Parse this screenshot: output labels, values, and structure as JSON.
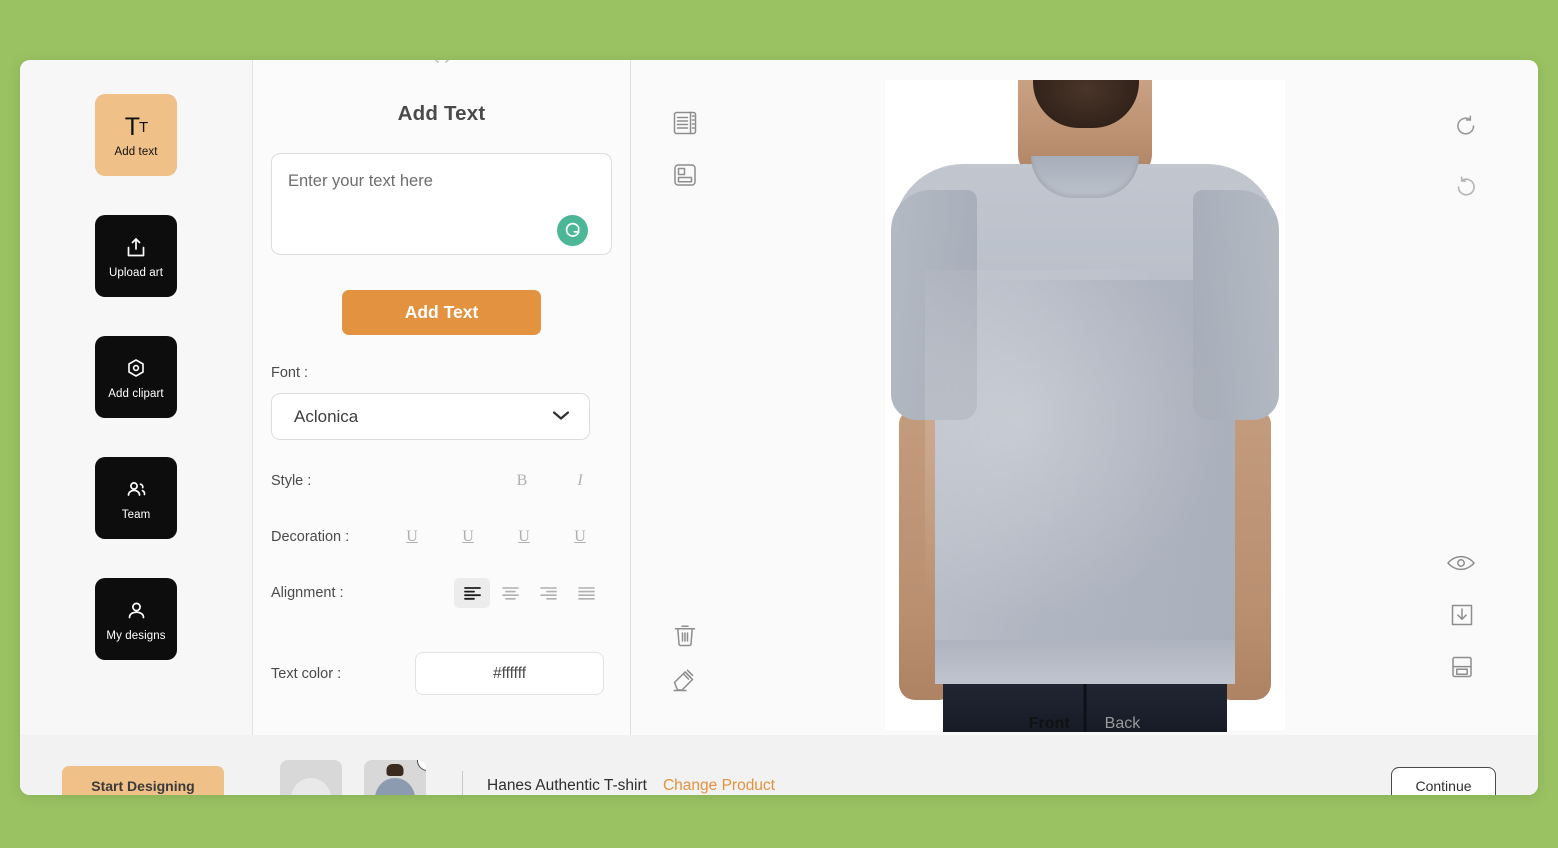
{
  "theme": {
    "page_background": "#9ac262",
    "accent_orange": "#e3923f",
    "accent_peach": "#f0c089",
    "grammar_green": "#4cb796",
    "shirt_color": "#b4bac4"
  },
  "sidebar": {
    "items": [
      {
        "label": "Add text",
        "icon": "text-tool-icon",
        "active": true
      },
      {
        "label": "Upload art",
        "icon": "upload-icon",
        "active": false
      },
      {
        "label": "Add clipart",
        "icon": "clipart-icon",
        "active": false
      },
      {
        "label": "Team",
        "icon": "team-icon",
        "active": false
      },
      {
        "label": "My designs",
        "icon": "my-designs-icon",
        "active": false
      }
    ]
  },
  "panel": {
    "title": "Add Text",
    "textarea_placeholder": "Enter your text here",
    "textarea_value": "",
    "grammar_icon": "grammarly-icon",
    "add_text_button": "Add Text",
    "font_label": "Font :",
    "font_value": "Aclonica",
    "style_label": "Style :",
    "style_options": [
      {
        "name": "bold",
        "glyph": "B",
        "selected": false
      },
      {
        "name": "italic",
        "glyph": "I",
        "selected": false
      }
    ],
    "decoration_label": "Decoration :",
    "decoration_options": [
      {
        "name": "underline",
        "glyph": "U",
        "selected": false
      },
      {
        "name": "double-underline",
        "glyph": "U",
        "selected": false
      },
      {
        "name": "dashed-underline",
        "glyph": "U",
        "selected": false
      },
      {
        "name": "dotted-underline",
        "glyph": "U",
        "selected": false
      }
    ],
    "alignment_label": "Alignment :",
    "alignment_options": [
      {
        "name": "align-left",
        "selected": true
      },
      {
        "name": "align-center",
        "selected": false
      },
      {
        "name": "align-right",
        "selected": false
      },
      {
        "name": "align-justify",
        "selected": false
      }
    ],
    "text_color_label": "Text color :",
    "text_color_value": "#ffffff"
  },
  "canvas": {
    "left_tools": [
      {
        "name": "layers-icon"
      },
      {
        "name": "template-icon"
      },
      {
        "name": "trash-icon"
      },
      {
        "name": "eraser-icon"
      }
    ],
    "right_tools": [
      {
        "name": "undo-icon"
      },
      {
        "name": "redo-icon"
      },
      {
        "name": "preview-eye-icon"
      },
      {
        "name": "download-icon"
      },
      {
        "name": "save-icon"
      }
    ],
    "side_tabs": [
      {
        "label": "Front",
        "active": true
      },
      {
        "label": "Back",
        "active": false
      }
    ]
  },
  "bottom_bar": {
    "cta_label": "Start Designing",
    "product_name": "Hanes Authentic T-shirt",
    "change_product_label": "Change Product",
    "right_button_label": "Continue",
    "thumbnails": [
      {
        "name": "product-thumb-white",
        "has_close": false
      },
      {
        "name": "product-thumb-gray",
        "has_close": true
      }
    ],
    "close_badge_glyph": "×"
  }
}
